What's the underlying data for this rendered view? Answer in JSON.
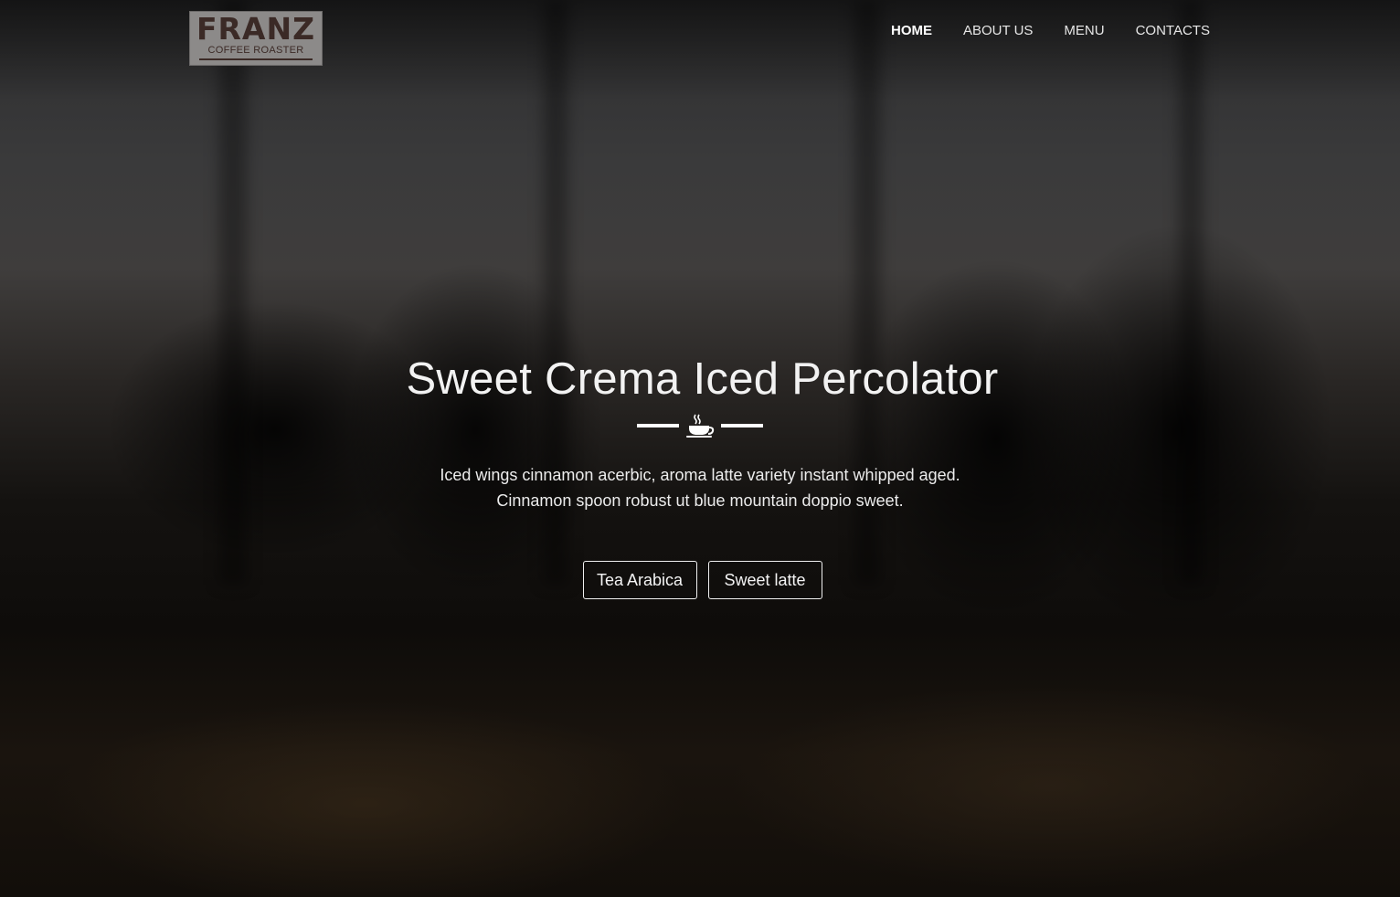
{
  "logo": {
    "name": "FRANZ",
    "tagline": "COFFEE ROASTER"
  },
  "nav": {
    "items": [
      {
        "label": "HOME",
        "active": true
      },
      {
        "label": "ABOUT US",
        "active": false
      },
      {
        "label": "MENU",
        "active": false
      },
      {
        "label": "CONTACTS",
        "active": false
      }
    ]
  },
  "hero": {
    "title": "Sweet Crema Iced Percolator",
    "divider_icon": "coffee-cup-icon",
    "description_lines": [
      "Iced wings cinnamon acerbic, aroma latte variety instant whipped aged.",
      "Cinnamon spoon robust ut blue mountain doppio sweet."
    ],
    "buttons": [
      {
        "label": "Tea Arabica"
      },
      {
        "label": "Sweet latte"
      }
    ]
  },
  "colors": {
    "text": "#ffffff",
    "logo_bg": "#8c8a89",
    "logo_text": "#3b2a26",
    "background_dark": "#0c0a08"
  }
}
